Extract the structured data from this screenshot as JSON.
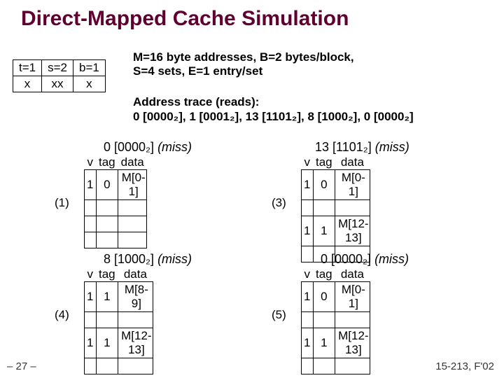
{
  "title": "Direct-Mapped Cache Simulation",
  "bits": {
    "h_t": "t=1",
    "h_s": "s=2",
    "h_b": "b=1",
    "v_t": "x",
    "v_s": "xx",
    "v_b": "x"
  },
  "params_l1": "M=16 byte addresses, B=2 bytes/block,",
  "params_l2": "S=4 sets, E=1 entry/set",
  "trace_h": "Address trace (reads):",
  "trace_l": "0 [0000₂], 1 [0001₂],  13 [1101₂],  8 [1000₂],  0 [0000₂]",
  "headers": {
    "v": "v",
    "tag": "tag",
    "data": "data"
  },
  "steps": {
    "s1": {
      "num": "(1)",
      "title_addr": "0 [0000₂]",
      "title_miss": "(miss)",
      "rows": [
        {
          "v": "1",
          "tag": "0",
          "data": "M[0-1]"
        },
        {
          "v": "",
          "tag": "",
          "data": ""
        },
        {
          "v": "",
          "tag": "",
          "data": ""
        },
        {
          "v": "",
          "tag": "",
          "data": ""
        }
      ]
    },
    "s3": {
      "num": "(3)",
      "title_addr": "13 [1101₂]",
      "title_miss": "(miss)",
      "rows": [
        {
          "v": "1",
          "tag": "0",
          "data": "M[0-1]"
        },
        {
          "v": "",
          "tag": "",
          "data": ""
        },
        {
          "v": "1",
          "tag": "1",
          "data": "M[12-13]"
        },
        {
          "v": "",
          "tag": "",
          "data": ""
        }
      ]
    },
    "s4": {
      "num": "(4)",
      "title_addr": "8 [1000₂]",
      "title_miss": "(miss)",
      "rows": [
        {
          "v": "1",
          "tag": "1",
          "data": "M[8-9]"
        },
        {
          "v": "",
          "tag": "",
          "data": ""
        },
        {
          "v": "1",
          "tag": "1",
          "data": "M[12-13]"
        },
        {
          "v": "",
          "tag": "",
          "data": ""
        }
      ]
    },
    "s5": {
      "num": "(5)",
      "title_addr": "0 [0000₂]",
      "title_miss": "(miss)",
      "rows": [
        {
          "v": "1",
          "tag": "0",
          "data": "M[0-1]"
        },
        {
          "v": "",
          "tag": "",
          "data": ""
        },
        {
          "v": "1",
          "tag": "1",
          "data": "M[12-13]"
        },
        {
          "v": "",
          "tag": "",
          "data": ""
        }
      ]
    }
  },
  "footer_left": "– 27 –",
  "footer_right": "15-213, F'02"
}
